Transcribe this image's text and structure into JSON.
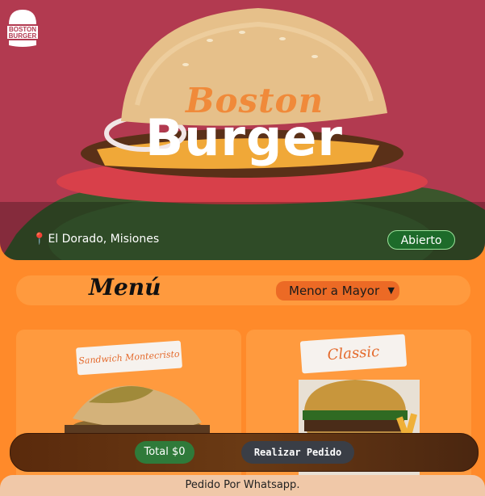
{
  "brand": {
    "logo_text_line1": "BOSTON",
    "logo_text_line2": "BURGER",
    "title_script": "Boston",
    "title_main": "Burger"
  },
  "hero": {
    "location": "El Dorado, Misiones",
    "status": "Abierto",
    "icons": {
      "location": "map-pin-icon"
    }
  },
  "menu": {
    "title": "Menú",
    "sort_selected": "Menor a Mayor"
  },
  "products": [
    {
      "name": "Sandwich Montecristo"
    },
    {
      "name": "Classic"
    }
  ],
  "cart": {
    "total": "Total $0",
    "order_button": "Realizar Pedido"
  },
  "footer": {
    "text": "Pedido Por Whatsapp."
  },
  "colors": {
    "background": "#ff8a2a",
    "hero_red": "#b23a50",
    "status_green": "#1d6b2a",
    "accent_orange": "#f08a3a"
  }
}
